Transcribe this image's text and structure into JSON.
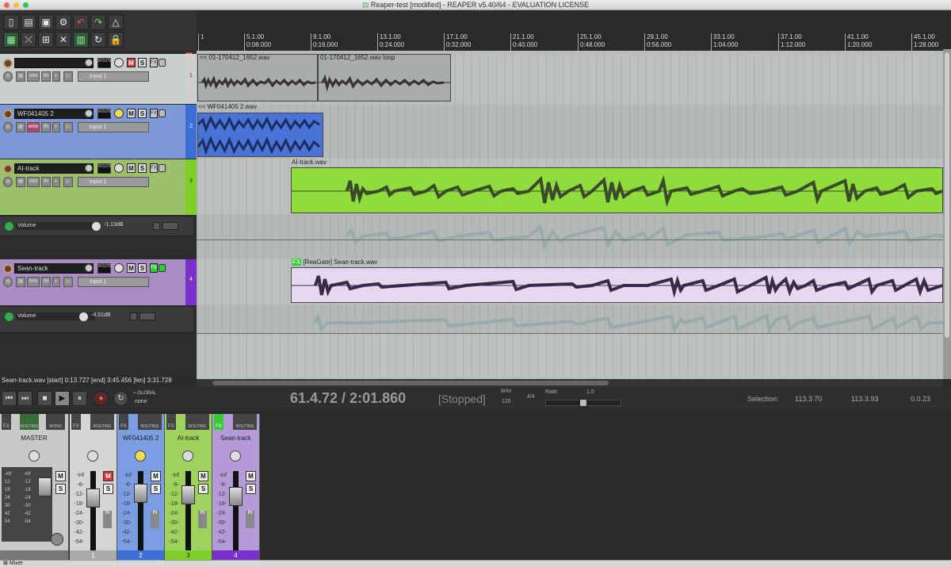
{
  "window": {
    "title": "Reaper-test [modified] - REAPER v5.40/64 - EVALUATION LICENSE",
    "title_icon": "document-icon"
  },
  "toolbar": {
    "row1": [
      "new-project-icon",
      "open-project-icon",
      "save-project-icon",
      "project-settings-icon",
      "undo-icon",
      "redo-icon",
      "metronome-icon"
    ],
    "row2": [
      "grid-icon",
      "ripple-icon",
      "snap-icon",
      "autocrossfade-icon",
      "envelope-icon",
      "loop-icon",
      "lock-icon"
    ]
  },
  "tracks": [
    {
      "name": "",
      "num": "1",
      "mode": "trim",
      "input": "Input 1",
      "color": "#c9cfcf",
      "strip_color": "#cfcfcf"
    },
    {
      "name": "WF041405 2",
      "num": "2",
      "mode": "write",
      "input": "Input 1",
      "color": "#7d9ad6",
      "strip_color": "#3b6fd6"
    },
    {
      "name": "AI-track",
      "num": "3",
      "mode": "trim",
      "input": "Input 1",
      "color": "#9cc06a",
      "strip_color": "#7fd12a"
    },
    {
      "name": "Sean-track",
      "num": "4",
      "mode": "trim",
      "input": "Input 1",
      "color": "#a98cc4",
      "strip_color": "#7a2fc8"
    }
  ],
  "envelopes": [
    {
      "name": "Volume",
      "value": "-1.13dB"
    },
    {
      "name": "Volume",
      "value": "-4.51dB"
    }
  ],
  "track_buttons": {
    "route": "ROUTE",
    "mute": "M",
    "solo": "S",
    "fx": "FX",
    "in": "IN"
  },
  "master_badge": "M",
  "ruler": [
    {
      "bar": "1",
      "time": ""
    },
    {
      "bar": "5.1.00",
      "time": "0:08.000"
    },
    {
      "bar": "9.1.00",
      "time": "0:16.000"
    },
    {
      "bar": "13.1.00",
      "time": "0:24.000"
    },
    {
      "bar": "17.1.00",
      "time": "0:32.000"
    },
    {
      "bar": "21.1.00",
      "time": "0:40.000"
    },
    {
      "bar": "25.1.00",
      "time": "0:48.000"
    },
    {
      "bar": "29.1.00",
      "time": "0:56.000"
    },
    {
      "bar": "33.1.00",
      "time": "1:04.000"
    },
    {
      "bar": "37.1.00",
      "time": "1:12.000"
    },
    {
      "bar": "41.1.00",
      "time": "1:20.000"
    },
    {
      "bar": "45.1.00",
      "time": "1:28.000"
    }
  ],
  "items": {
    "track1_a": "<< 01-170412_1652.wav",
    "track1_b": "01-170412_1652.wav loop",
    "track2": "<< WF041405 2.wav",
    "track3": "AI-track.wav",
    "track4_fx": "FX",
    "track4": "[ReaGate] Sean-track.wav"
  },
  "status": "Sean-track.wav [start] 0:13.727 [end] 3:45.456 [len] 3:31.728",
  "transport": {
    "position": "61.4.72 / 2:01.860",
    "state": "[Stopped]",
    "bpm_label": "BPM",
    "bpm": "120",
    "timesig": "4/4",
    "rate_label": "Rate:",
    "rate": "1.0",
    "global_label": "GLOBAL",
    "global_value": "none",
    "selection_label": "Selection:",
    "sel_start": "113.3.70",
    "sel_end": "113.3.93",
    "sel_len": "0.0.23"
  },
  "mixer": {
    "fx": "FX",
    "routing": "ROUTING",
    "mono": "MONO",
    "strips": [
      {
        "name": "MASTER",
        "num": "",
        "color": "#c9c9c9"
      },
      {
        "name": "",
        "num": "1",
        "color": "#d5d5d5"
      },
      {
        "name": "WF041405 2",
        "num": "2",
        "color": "#7b9ee3"
      },
      {
        "name": "AI-track",
        "num": "3",
        "color": "#9fd25c"
      },
      {
        "name": "Sean-track",
        "num": "4",
        "color": "#b59ad8"
      }
    ],
    "db_scale": [
      "-inf",
      "-6-",
      "-12-",
      "-18-",
      "-24-",
      "-30-",
      "-42-",
      "-54-"
    ],
    "tab": "Mixer"
  },
  "colors": {
    "track2_item": "#4a73d8",
    "track3_item": "#8fdc3c",
    "track4_item": "#e6d8f0",
    "wave_dark": "#2a2a2a"
  }
}
